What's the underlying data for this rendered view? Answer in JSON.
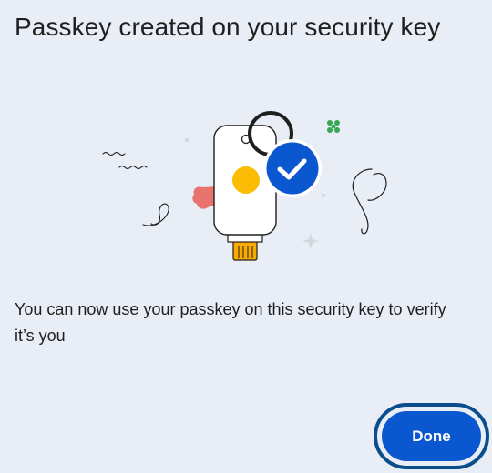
{
  "dialog": {
    "title": "Passkey created on your security key",
    "description": "You can now use your passkey on this security key to verify it’s you",
    "done_label": "Done"
  },
  "illustration": {
    "icons": [
      "security-key-icon",
      "checkmark-badge-icon",
      "key-ring-icon",
      "sparkle-icon"
    ],
    "colors": {
      "badge_blue": "#0b57d0",
      "yellow_dot": "#fbbc04",
      "red_shape": "#e8736c",
      "green_sparkle": "#34a853",
      "key_contact_gold": "#f9ab00"
    }
  },
  "colors": {
    "background": "#e8edf6",
    "primary_button": "#0b57d0",
    "focus_ring": "#0a4f8c",
    "text": "#1f1f1f"
  }
}
